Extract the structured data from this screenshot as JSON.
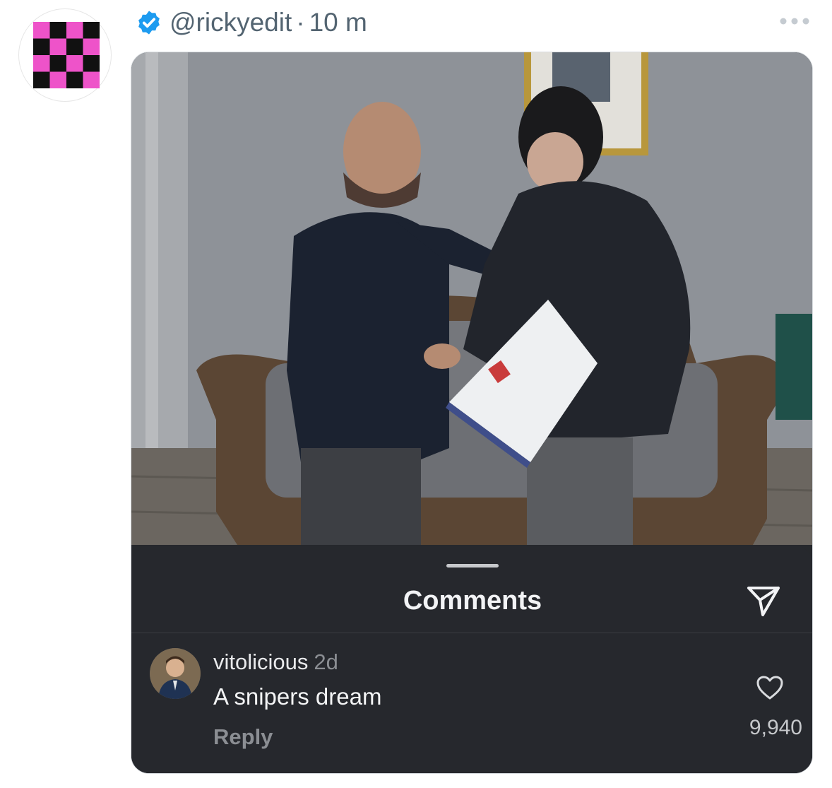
{
  "post": {
    "handle": "@rickyedit",
    "separator": "·",
    "time": "10 m"
  },
  "icons": {
    "verified": "verified-badge-icon",
    "more": "more-options-icon",
    "send": "send-icon",
    "heart": "heart-icon"
  },
  "colors": {
    "verified": "#1d9bf0",
    "avatar_pink": "#ee53c9",
    "avatar_black": "#111111",
    "sheet_bg": "#26282d"
  },
  "comments_panel": {
    "title": "Comments",
    "comment": {
      "username": "vitolicious",
      "age": "2d",
      "text": "A snipers dream",
      "reply_label": "Reply",
      "likes": "9,940"
    }
  }
}
